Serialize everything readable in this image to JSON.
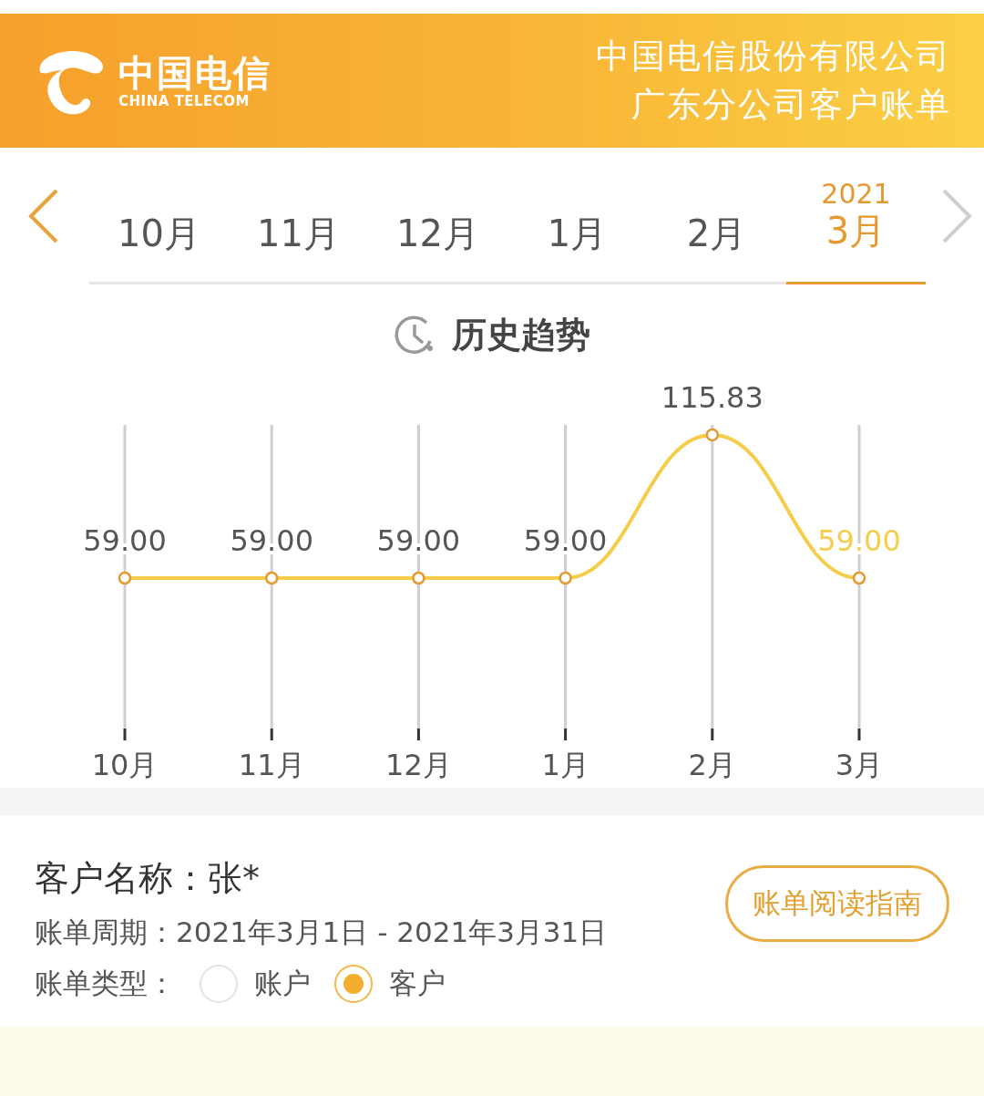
{
  "header": {
    "logo_cn": "中国电信",
    "logo_en": "CHINA TELECOM",
    "title_lines": [
      "中国电信股份有限公司",
      "广东分公司客户账单"
    ]
  },
  "months": [
    {
      "label": "10月",
      "selected": false
    },
    {
      "label": "11月",
      "selected": false
    },
    {
      "label": "12月",
      "selected": false
    },
    {
      "label": "1月",
      "selected": false
    },
    {
      "label": "2月",
      "selected": false
    },
    {
      "label": "3月",
      "year": "2021",
      "selected": true
    }
  ],
  "trend": {
    "title": "历史趋势",
    "chart_data": {
      "type": "line",
      "categories": [
        "10月",
        "11月",
        "12月",
        "1月",
        "2月",
        "3月"
      ],
      "data_labels": true,
      "series": [
        {
          "color": "#f5cd4a",
          "marker": "circle",
          "values": [
            59.0,
            59.0,
            59.0,
            59.0,
            115.83,
            59.0
          ],
          "value_labels": [
            "59.00",
            "59.00",
            "59.00",
            "59.00",
            "115.83",
            "59.00"
          ]
        }
      ],
      "grid": true
    }
  },
  "info": {
    "customer_label": "客户名称：",
    "customer_value": "张*",
    "period_label": "账单周期：",
    "period_value": "2021年3月1日 - 2021年3月31日",
    "type_label": "账单类型：",
    "types": [
      {
        "label": "账户",
        "selected": false
      },
      {
        "label": "客户",
        "selected": true
      }
    ],
    "guide_button": "账单阅读指南"
  }
}
